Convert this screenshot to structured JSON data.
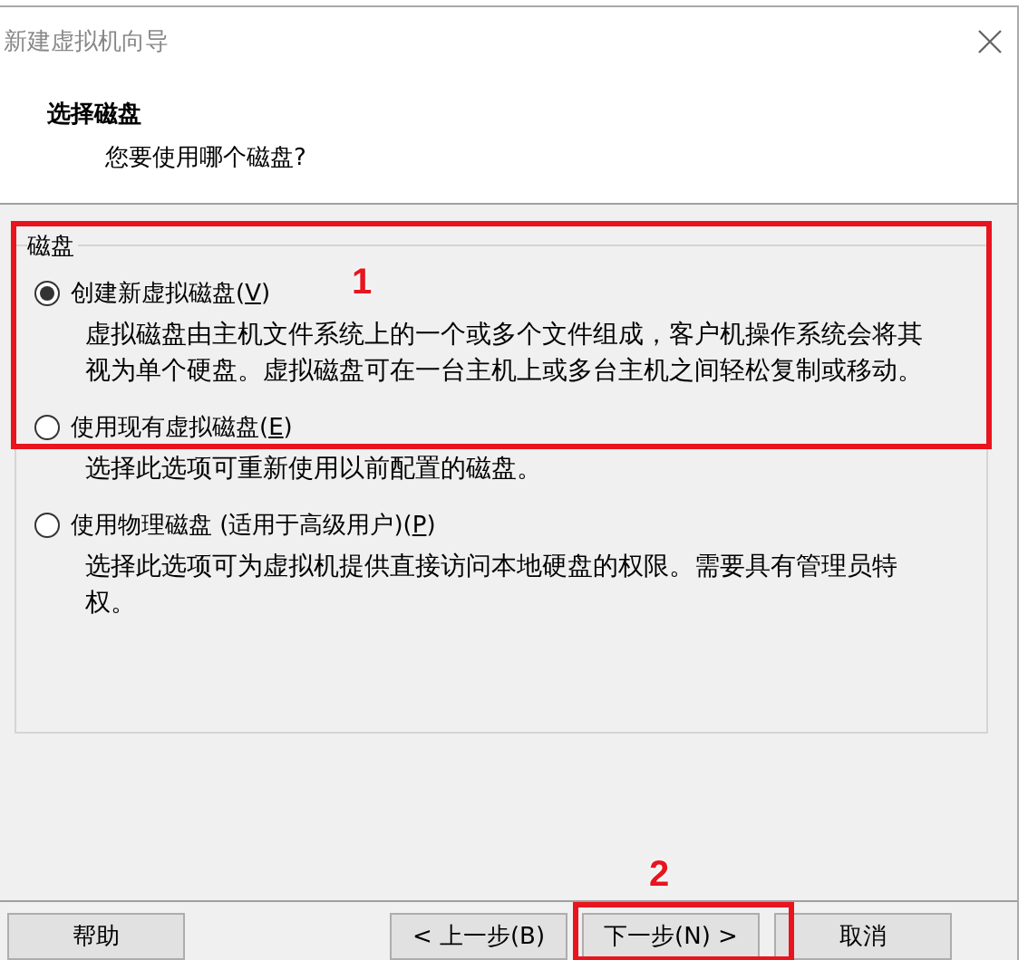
{
  "window": {
    "title": "新建虚拟机向导"
  },
  "header": {
    "title": "选择磁盘",
    "subtitle": "您要使用哪个磁盘?"
  },
  "group": {
    "legend": "磁盘",
    "options": [
      {
        "label_before": "创建新虚拟磁盘(",
        "access_key": "V",
        "label_after": ")",
        "selected": true,
        "description": "虚拟磁盘由主机文件系统上的一个或多个文件组成，客户机操作系统会将其视为单个硬盘。虚拟磁盘可在一台主机上或多台主机之间轻松复制或移动。"
      },
      {
        "label_before": "使用现有虚拟磁盘(",
        "access_key": "E",
        "label_after": ")",
        "selected": false,
        "description": "选择此选项可重新使用以前配置的磁盘。"
      },
      {
        "label_before": "使用物理磁盘 (适用于高级用户)(",
        "access_key": "P",
        "label_after": ")",
        "selected": false,
        "description": "选择此选项可为虚拟机提供直接访问本地硬盘的权限。需要具有管理员特权。"
      }
    ]
  },
  "buttons": [
    {
      "label": "帮助"
    },
    {
      "label": "< 上一步(B)"
    },
    {
      "label": "下一步(N) >"
    },
    {
      "label": "取消"
    }
  ],
  "annotations": [
    {
      "number": "1"
    },
    {
      "number": "2"
    }
  ]
}
